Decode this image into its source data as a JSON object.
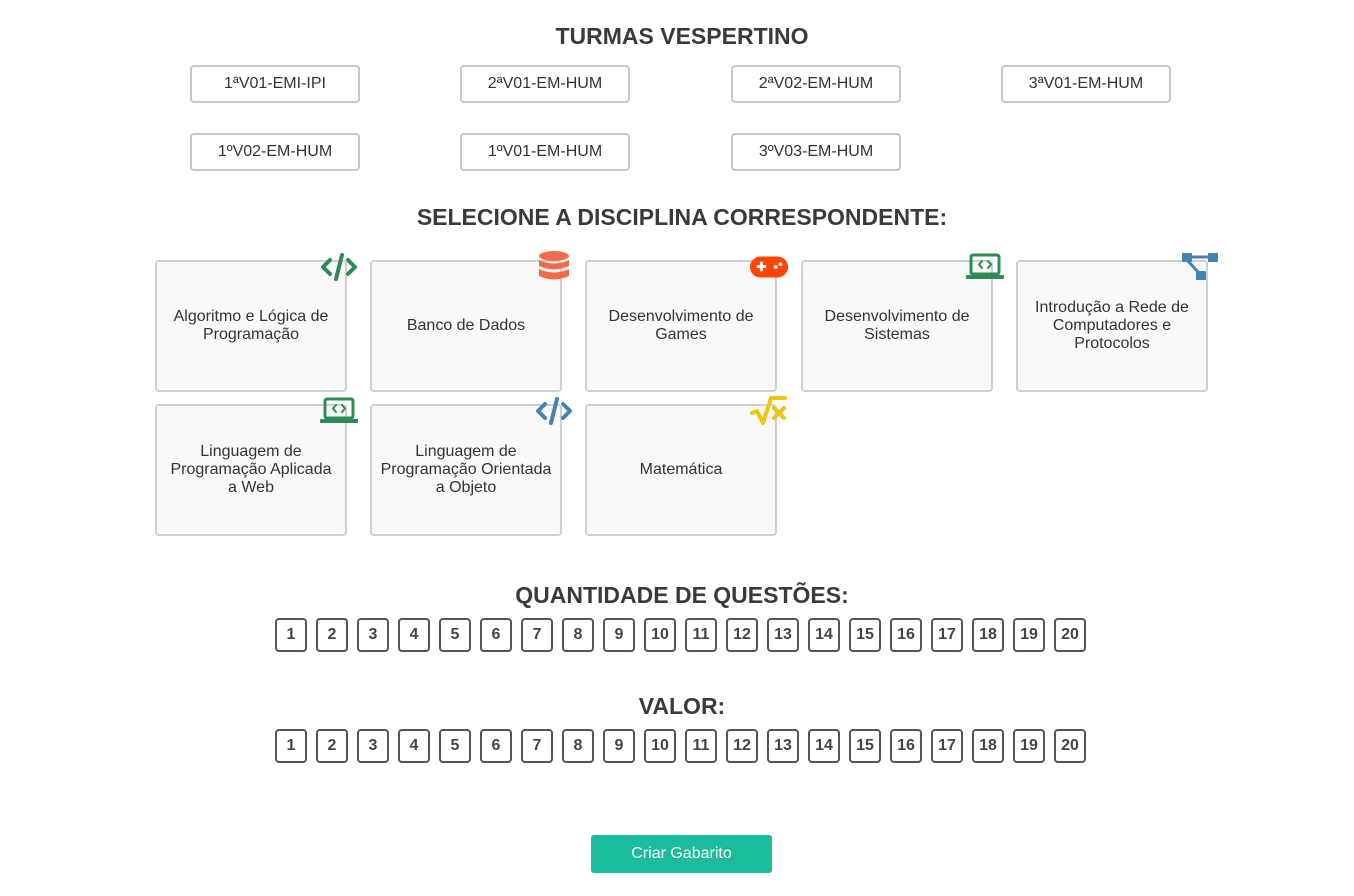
{
  "turmas": {
    "title": "TURMAS VESPERTINO",
    "items": [
      "1ªV01-EMI-IPI",
      "2ªV01-EM-HUM",
      "2ªV02-EM-HUM",
      "3ªV01-EM-HUM",
      "1ºV02-EM-HUM",
      "1ºV01-EM-HUM",
      "3ºV03-EM-HUM"
    ]
  },
  "disciplinas": {
    "title": "SELECIONE A DISCIPLINA CORRESPONDENTE:",
    "items": [
      {
        "label": "Algoritmo e Lógica de Programação",
        "icon": "code-icon",
        "color": "#2e8b57"
      },
      {
        "label": "Banco de Dados",
        "icon": "database-icon",
        "color": "#f26b4a"
      },
      {
        "label": "Desenvolvimento de Games",
        "icon": "gamepad-icon",
        "color": "#ff4500"
      },
      {
        "label": "Desenvolvimento de Sistemas",
        "icon": "laptop-code-icon",
        "color": "#2e8b57"
      },
      {
        "label": "Introdução a Rede de Computadores e Protocolos",
        "icon": "network-icon",
        "color": "#4682b4"
      },
      {
        "label": "Linguagem de Programação Aplicada a Web",
        "icon": "laptop-code-icon",
        "color": "#2e8b57"
      },
      {
        "label": "Linguagem de Programação Orientada a Objeto",
        "icon": "code-icon",
        "color": "#4682b4"
      },
      {
        "label": "Matemática",
        "icon": "square-root-icon",
        "color": "#f1c40f"
      }
    ]
  },
  "quantidade": {
    "title": "QUANTIDADE DE QUESTÕES:",
    "options": [
      "1",
      "2",
      "3",
      "4",
      "5",
      "6",
      "7",
      "8",
      "9",
      "10",
      "11",
      "12",
      "13",
      "14",
      "15",
      "16",
      "17",
      "18",
      "19",
      "20"
    ]
  },
  "valor": {
    "title": "VALOR:",
    "options": [
      "1",
      "2",
      "3",
      "4",
      "5",
      "6",
      "7",
      "8",
      "9",
      "10",
      "11",
      "12",
      "13",
      "14",
      "15",
      "16",
      "17",
      "18",
      "19",
      "20"
    ]
  },
  "submit_label": "Criar Gabarito",
  "accent_color": "#1abc9c"
}
